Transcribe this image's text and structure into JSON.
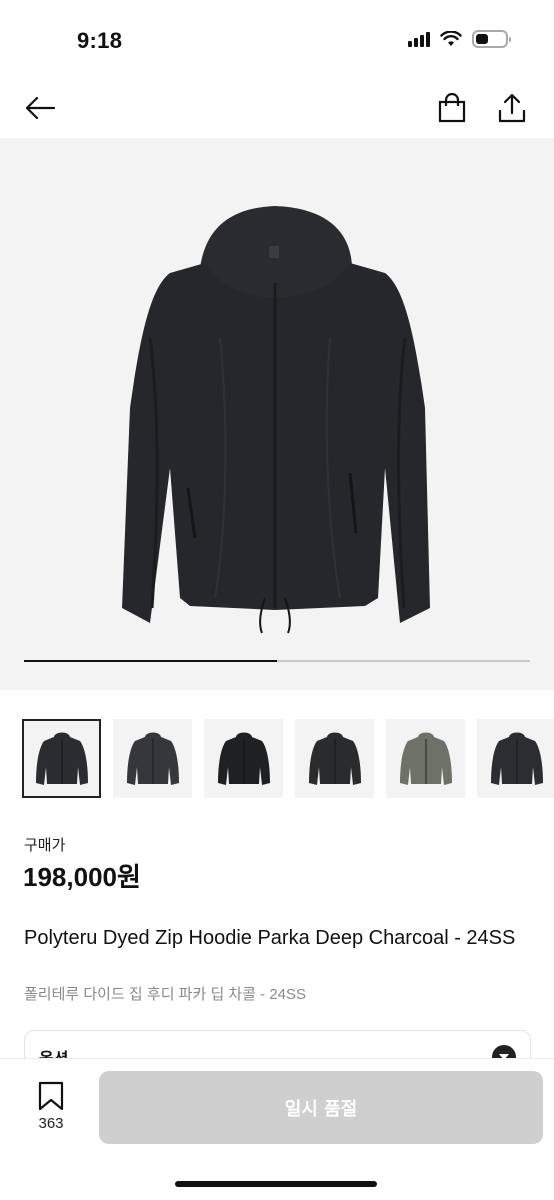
{
  "status_bar": {
    "time": "9:18"
  },
  "nav": {
    "back_icon": "arrow-left-icon",
    "bag_icon": "shopping-bag-icon",
    "share_icon": "share-icon"
  },
  "gallery": {
    "slide_progress": 0.5,
    "thumbnails": [
      {
        "name": "thumb-1",
        "color": "#2b2c2f",
        "selected": true
      },
      {
        "name": "thumb-2",
        "color": "#35373a",
        "selected": false
      },
      {
        "name": "thumb-3",
        "color": "#1f2022",
        "selected": false
      },
      {
        "name": "thumb-4",
        "color": "#2a2b2d",
        "selected": false
      },
      {
        "name": "thumb-5",
        "color": "#6e7167",
        "selected": false
      },
      {
        "name": "thumb-6",
        "color": "#2c2d30",
        "selected": false
      }
    ]
  },
  "product": {
    "price_label": "구매가",
    "price": "198,000원",
    "title": "Polyteru Dyed Zip Hoodie Parka Deep Charcoal - 24SS",
    "subtitle": "폴리테루 다이드 집 후디 파카 딥 차콜 - 24SS"
  },
  "option": {
    "label": "옵션",
    "chevron_icon": "chevron-down-icon"
  },
  "bottom_bar": {
    "bookmark_icon": "bookmark-icon",
    "bookmark_count": "363",
    "buy_button": "일시 품절"
  },
  "colors": {
    "accent": "#111111",
    "disabled_button": "#cfcfcf",
    "image_bg": "#f3f3f3"
  }
}
